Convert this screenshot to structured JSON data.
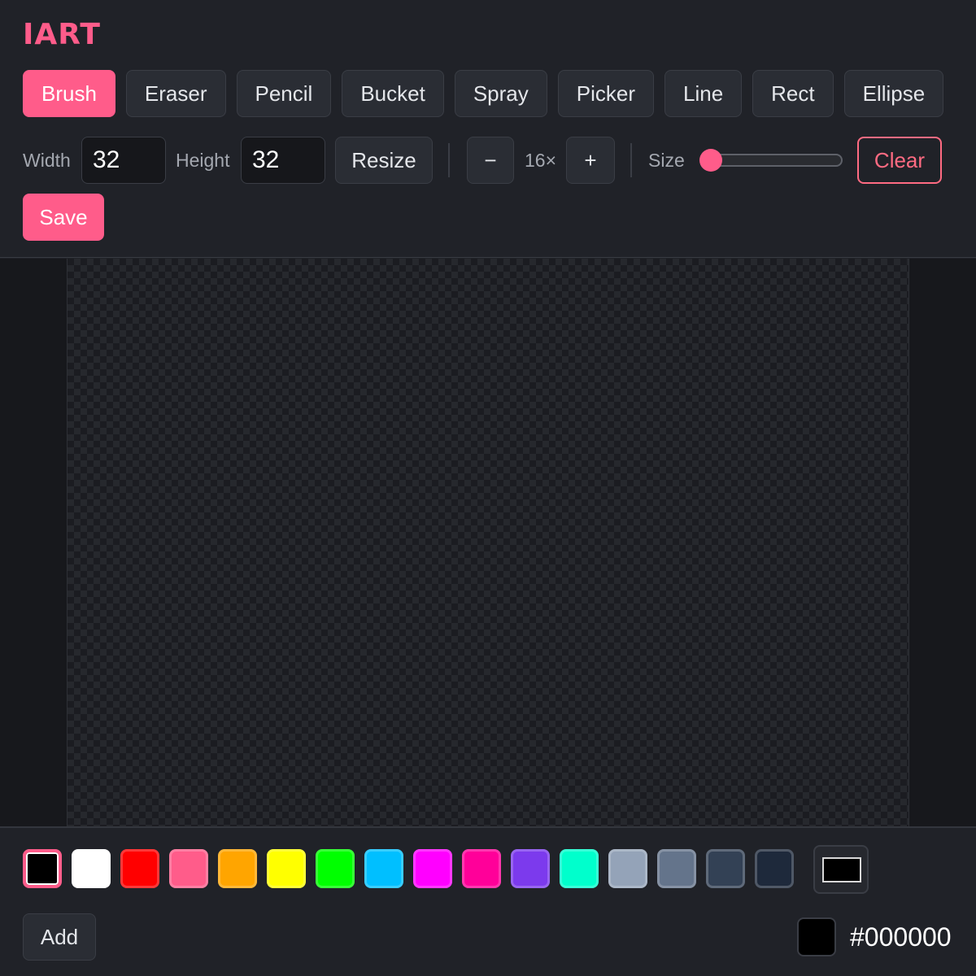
{
  "app": {
    "title": "IART"
  },
  "tools": [
    {
      "label": "Brush",
      "active": true
    },
    {
      "label": "Eraser",
      "active": false
    },
    {
      "label": "Pencil",
      "active": false
    },
    {
      "label": "Bucket",
      "active": false
    },
    {
      "label": "Spray",
      "active": false
    },
    {
      "label": "Picker",
      "active": false
    },
    {
      "label": "Line",
      "active": false
    },
    {
      "label": "Rect",
      "active": false
    },
    {
      "label": "Ellipse",
      "active": false
    }
  ],
  "canvas_settings": {
    "width_label": "Width",
    "width_value": "32",
    "height_label": "Height",
    "height_value": "32",
    "resize_label": "Resize"
  },
  "zoom": {
    "minus_label": "−",
    "value": "16×",
    "plus_label": "+"
  },
  "brush_size": {
    "label": "Size",
    "level": 0
  },
  "actions": {
    "clear_label": "Clear",
    "save_label": "Save"
  },
  "palette": {
    "swatches": [
      {
        "color": "#000000",
        "selected": true
      },
      {
        "color": "#ffffff",
        "selected": false
      },
      {
        "color": "#ff0000",
        "selected": false
      },
      {
        "color": "#ff5c8a",
        "selected": false
      },
      {
        "color": "#ffa500",
        "selected": false
      },
      {
        "color": "#ffff00",
        "selected": false
      },
      {
        "color": "#00ff00",
        "selected": false
      },
      {
        "color": "#00bfff",
        "selected": false
      },
      {
        "color": "#ff00ff",
        "selected": false
      },
      {
        "color": "#ff0099",
        "selected": false
      },
      {
        "color": "#7c3aed",
        "selected": false
      },
      {
        "color": "#00ffcc",
        "selected": false
      },
      {
        "color": "#94a3b8",
        "selected": false
      },
      {
        "color": "#64748b",
        "selected": false
      },
      {
        "color": "#334155",
        "selected": false
      },
      {
        "color": "#1e293b",
        "selected": false
      }
    ],
    "add_label": "Add"
  },
  "current_color": {
    "hex": "#000000"
  },
  "colors": {
    "accent": "#ff5c8a",
    "danger": "#ff6b82",
    "background": "#202228"
  }
}
